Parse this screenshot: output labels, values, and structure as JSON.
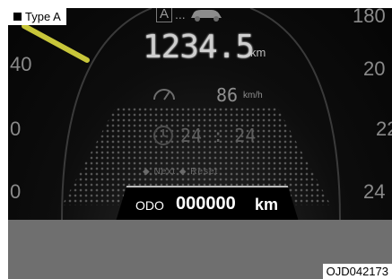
{
  "labels": {
    "type": "Type A",
    "code": "OJD042173"
  },
  "cluster": {
    "mode_letter": "A",
    "mode_dots": "...",
    "trip_value": "1234.5",
    "trip_unit": "km",
    "speed_value": "86",
    "speed_unit": "km/h",
    "time_value": "24 : 24",
    "hint_text": "◆ Next ◆ Reset",
    "ticks_left": [
      "40",
      "0",
      "0"
    ],
    "ticks_right": [
      "180",
      "20",
      "22",
      "24"
    ],
    "odometer": {
      "label": "ODO",
      "value": "000000",
      "unit": "km"
    }
  },
  "icons": [
    "speedometer-icon",
    "clock-icon",
    "car-icon"
  ],
  "colors": {
    "needle": "#c8c63a",
    "background": "#050505",
    "text": "#ffffff"
  }
}
